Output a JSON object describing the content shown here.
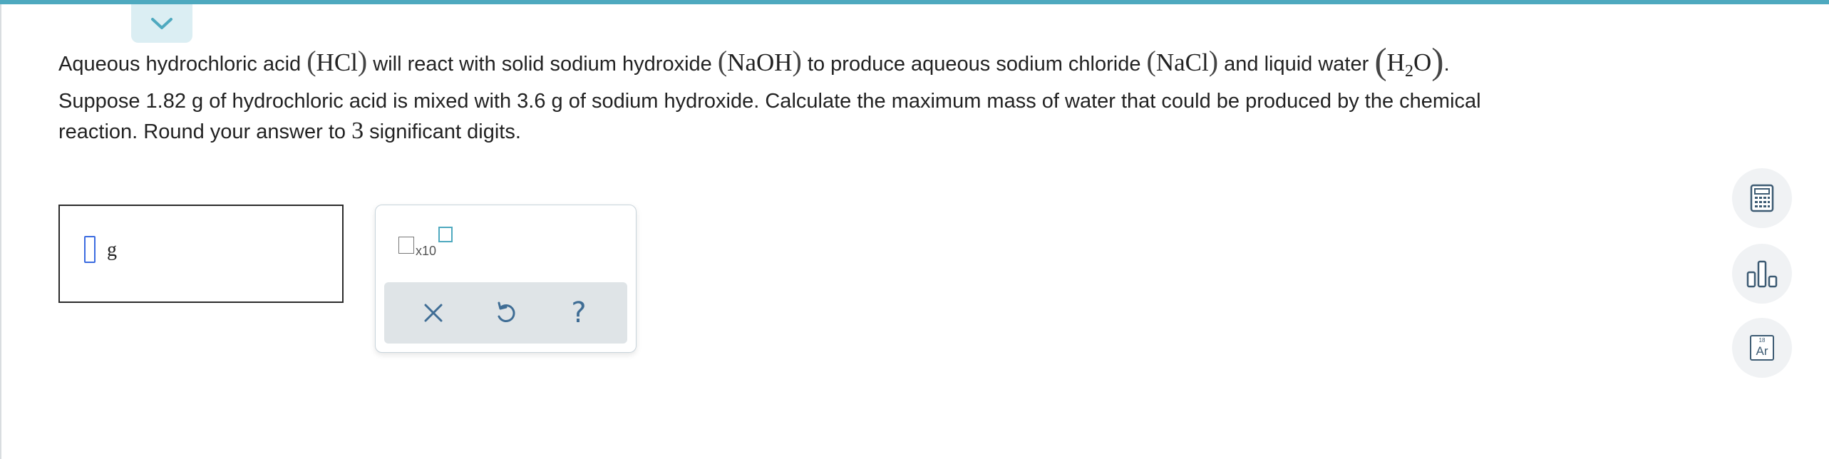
{
  "question": {
    "line1": {
      "t1": "Aqueous hydrochloric acid",
      "hcl": "HCl",
      "t2": "will react with solid sodium hydroxide",
      "naoh": "NaOH",
      "t3": "to produce aqueous sodium chloride",
      "nacl": "NaCl",
      "t4": "and liquid water",
      "water_h": "H",
      "water_sub": "2",
      "water_o": "O",
      "end": "."
    },
    "line2": "Suppose 1.82 g of hydrochloric acid is mixed with 3.6 g of sodium hydroxide. Calculate the maximum mass of water that could be produced by the chemical",
    "line3_a": "reaction. Round your answer to",
    "line3_num": "3",
    "line3_b": "significant digits."
  },
  "answer": {
    "unit": "g",
    "value": ""
  },
  "palette": {
    "sci_label": "x10"
  },
  "icons": {
    "collapse": "chevron-down-icon",
    "calculator": "calculator-icon",
    "chart": "bar-chart-icon",
    "periodic_table": "periodic-table-icon",
    "clear": "close-icon",
    "undo": "undo-icon",
    "help": "help-icon"
  },
  "periodic_tile": {
    "number": "18",
    "symbol": "Ar"
  },
  "colors": {
    "accent": "#4ea9bf",
    "icon": "#3d5b73",
    "cursor": "#3b6be0"
  }
}
